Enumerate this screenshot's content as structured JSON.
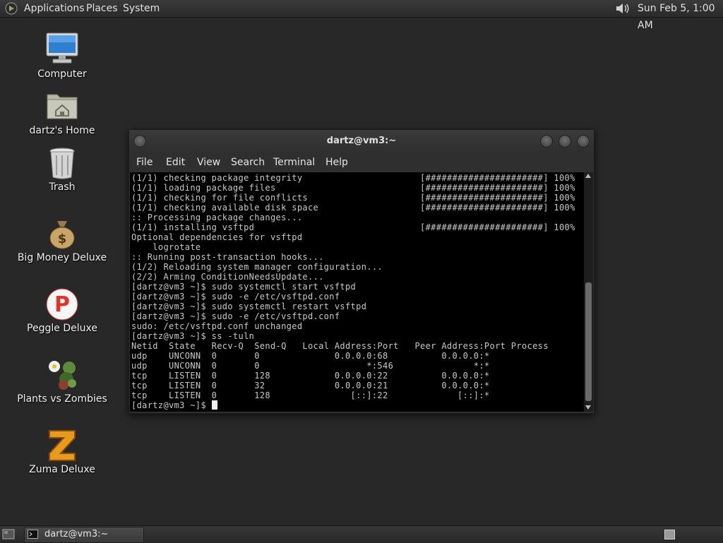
{
  "top_panel": {
    "applications": "Applications",
    "places": "Places",
    "system": "System",
    "clock": "Sun Feb  5,  1:00 AM"
  },
  "desktop": {
    "icons": [
      {
        "label": "Computer",
        "icon": "computer-icon"
      },
      {
        "label": "dartz's Home",
        "icon": "home-folder-icon"
      },
      {
        "label": "Trash",
        "icon": "trash-icon"
      },
      {
        "label": "Big Money Deluxe",
        "icon": "money-bag-icon"
      },
      {
        "label": "Peggle Deluxe",
        "icon": "peggle-icon"
      },
      {
        "label": "Plants vs Zombies",
        "icon": "plants-vs-zombies-icon"
      },
      {
        "label": "Zuma Deluxe",
        "icon": "zuma-icon"
      }
    ]
  },
  "terminal": {
    "title": "dartz@vm3:~",
    "menu": [
      "File",
      "Edit",
      "View",
      "Search",
      "Terminal",
      "Help"
    ],
    "lines": [
      "(1/1) checking package integrity                      [######################] 100%",
      "(1/1) loading package files                           [######################] 100%",
      "(1/1) checking for file conflicts                     [######################] 100%",
      "(1/1) checking available disk space                   [######################] 100%",
      ":: Processing package changes...",
      "(1/1) installing vsftpd                               [######################] 100%",
      "Optional dependencies for vsftpd",
      "    logrotate",
      ":: Running post-transaction hooks...",
      "(1/2) Reloading system manager configuration...",
      "(2/2) Arming ConditionNeedsUpdate...",
      "[dartz@vm3 ~]$ sudo systemctl start vsftpd",
      "[dartz@vm3 ~]$ sudo -e /etc/vsftpd.conf",
      "[dartz@vm3 ~]$ sudo systemctl restart vsftpd",
      "[dartz@vm3 ~]$ sudo -e /etc/vsftpd.conf",
      "sudo: /etc/vsftpd.conf unchanged",
      "[dartz@vm3 ~]$ ss -tuln",
      "Netid  State   Recv-Q  Send-Q   Local Address:Port   Peer Address:Port Process",
      "udp    UNCONN  0       0              0.0.0.0:68          0.0.0.0:*",
      "udp    UNCONN  0       0                    *:546               *:*",
      "tcp    LISTEN  0       128            0.0.0.0:22          0.0.0.0:*",
      "tcp    LISTEN  0       32             0.0.0.0:21          0.0.0.0:*",
      "tcp    LISTEN  0       128               [::]:22             [::]:*"
    ],
    "prompt": "[dartz@vm3 ~]$ "
  },
  "taskbar": {
    "items": [
      {
        "label": "dartz@vm3:~"
      }
    ]
  }
}
